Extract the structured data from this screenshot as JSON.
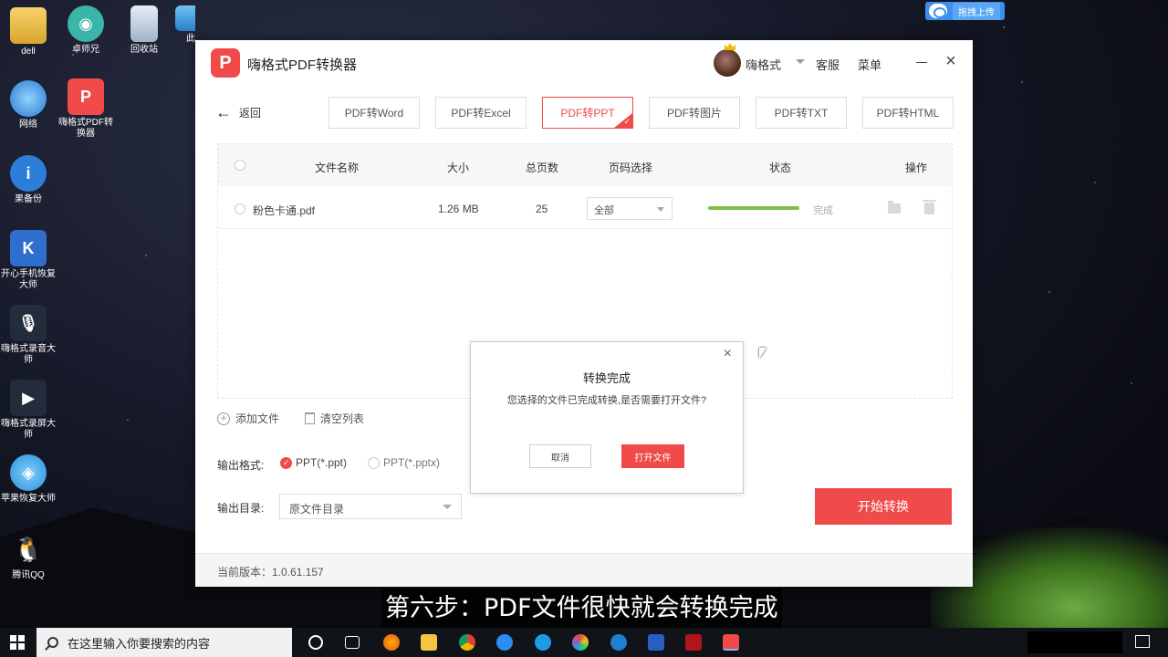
{
  "desktop": {
    "icons": [
      {
        "label": "dell"
      },
      {
        "label": "卓师兄"
      },
      {
        "label": "回收站"
      },
      {
        "label": "此"
      },
      {
        "label": "网络"
      },
      {
        "label": "嗨格式PDF转换器"
      },
      {
        "label": "果备份"
      },
      {
        "label": "开心手机恢复大师"
      },
      {
        "label": "嗨格式录音大师"
      },
      {
        "label": "嗨格式录屏大师"
      },
      {
        "label": "苹果恢复大师"
      },
      {
        "label": "腾讯QQ"
      }
    ],
    "upload_button": "拖拽上传"
  },
  "app": {
    "title": "嗨格式PDF转换器",
    "logo_glyph": "P",
    "user_name": "嗨格式",
    "service": "客服",
    "menu": "菜单",
    "back_label": "返回",
    "tabs": [
      {
        "label": "PDF转Word",
        "active": false
      },
      {
        "label": "PDF转Excel",
        "active": false
      },
      {
        "label": "PDF转PPT",
        "active": true
      },
      {
        "label": "PDF转图片",
        "active": false
      },
      {
        "label": "PDF转TXT",
        "active": false
      },
      {
        "label": "PDF转HTML",
        "active": false
      }
    ],
    "table": {
      "headers": {
        "name": "文件名称",
        "size": "大小",
        "pages": "总页数",
        "page_select": "页码选择",
        "status": "状态",
        "action": "操作"
      },
      "rows": [
        {
          "name": "粉色卡通.pdf",
          "size": "1.26 MB",
          "pages": "25",
          "page_select": "全部",
          "progress_percent": 100,
          "status": "完成"
        }
      ]
    },
    "dialog": {
      "title": "转换完成",
      "message": "您选择的文件已完成转换,是否需要打开文件?",
      "cancel": "取消",
      "open": "打开文件"
    },
    "add_file": "添加文件",
    "clear_list": "清空列表",
    "output_format_label": "输出格式:",
    "format_options": [
      {
        "label": "PPT(*.ppt)",
        "selected": true
      },
      {
        "label": "PPT(*.pptx)",
        "selected": false
      }
    ],
    "output_dir_label": "输出目录:",
    "output_dir_value": "原文件目录",
    "start_button": "开始转换",
    "version": "当前版本：1.0.61.157"
  },
  "subtitle": "第六步：PDF文件很快就会转换完成",
  "taskbar": {
    "search_placeholder": "在这里输入你要搜索的内容"
  },
  "colors": {
    "accent": "#f04a4a",
    "progress": "#7ac143"
  }
}
